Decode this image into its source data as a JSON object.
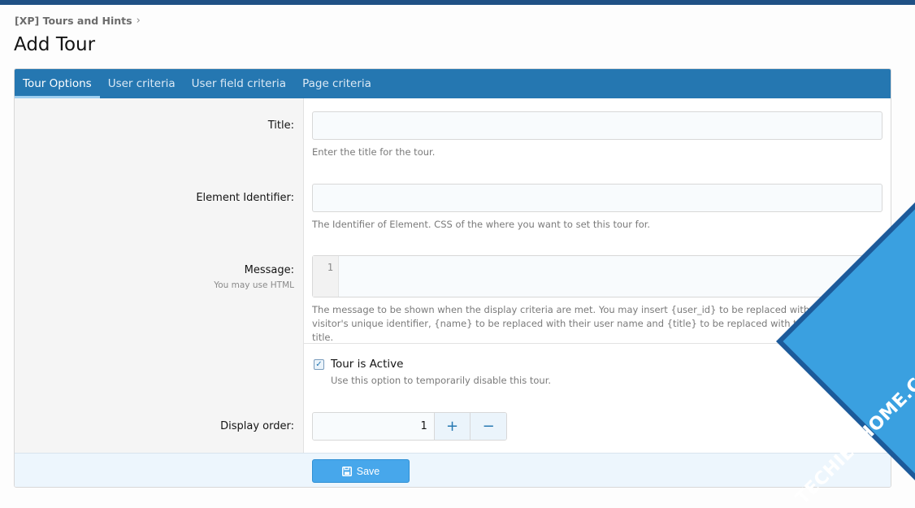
{
  "breadcrumb": {
    "parent": "[XP] Tours and Hints"
  },
  "page_title": "Add Tour",
  "tabs": [
    {
      "label": "Tour Options",
      "active": true
    },
    {
      "label": "User criteria"
    },
    {
      "label": "User field criteria"
    },
    {
      "label": "Page criteria"
    }
  ],
  "form": {
    "title": {
      "label": "Title:",
      "hint": "Enter the title for the tour.",
      "value": ""
    },
    "element_identifier": {
      "label": "Element Identifier:",
      "hint": "The Identifier of Element. CSS of the where you want to set this tour for.",
      "value": ""
    },
    "message": {
      "label": "Message:",
      "sublabel": "You may use HTML",
      "line_number": "1",
      "hint": "The message to be shown when the display criteria are met. You may insert {user_id} to be replaced with the current visitor's unique identifier, {name} to be replaced with their user name and {title} to be replaced with this notice's title."
    },
    "active": {
      "label": "Tour is Active",
      "hint": "Use this option to temporarily disable this tour.",
      "checked": true
    },
    "display_order": {
      "label": "Display order:",
      "value": "1",
      "plus": "+",
      "minus": "−"
    }
  },
  "footer": {
    "save_label": "Save"
  },
  "watermark": {
    "text": "TECHIESHOME.COM"
  },
  "colors": {
    "accent": "#2577b1",
    "topbar": "#1f5185",
    "button": "#47a7eb"
  }
}
